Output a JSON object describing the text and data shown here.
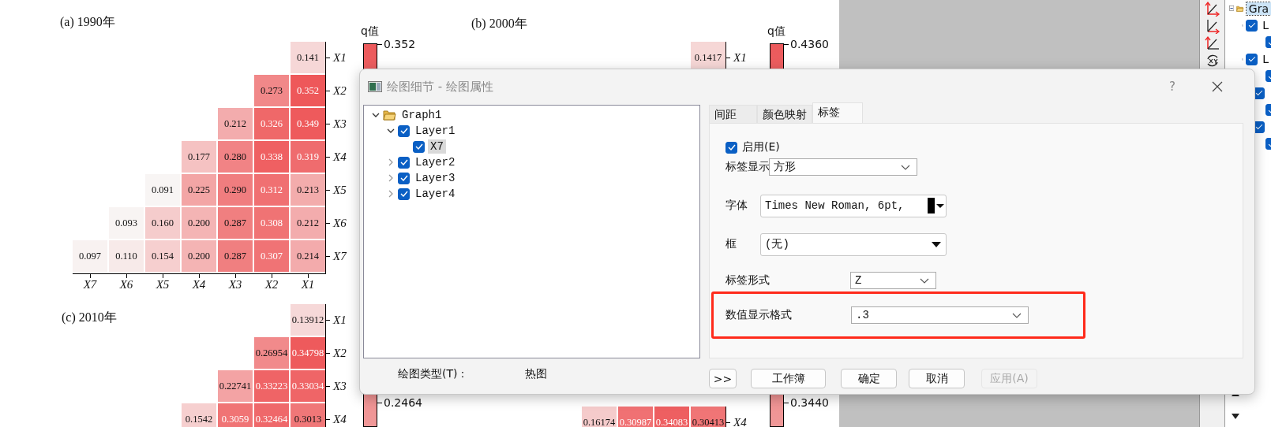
{
  "panel_a": {
    "title": "(a) 1990年",
    "rows": [
      {
        "label": "X1",
        "cells": [
          "",
          "",
          "",
          "",
          "",
          "",
          "0.141"
        ]
      },
      {
        "label": "X2",
        "cells": [
          "",
          "",
          "",
          "",
          "",
          "0.273",
          "0.352"
        ]
      },
      {
        "label": "X3",
        "cells": [
          "",
          "",
          "",
          "",
          "0.212",
          "0.326",
          "0.349"
        ]
      },
      {
        "label": "X4",
        "cells": [
          "",
          "",
          "",
          "0.177",
          "0.280",
          "0.338",
          "0.319"
        ]
      },
      {
        "label": "X5",
        "cells": [
          "",
          "",
          "0.091",
          "0.225",
          "0.290",
          "0.312",
          "0.213"
        ]
      },
      {
        "label": "X6",
        "cells": [
          "",
          "0.093",
          "0.160",
          "0.200",
          "0.287",
          "0.308",
          "0.212"
        ]
      },
      {
        "label": "X7",
        "cells": [
          "0.097",
          "0.110",
          "0.154",
          "0.200",
          "0.287",
          "0.307",
          "0.214"
        ]
      }
    ],
    "x_labels": [
      "X7",
      "X6",
      "X5",
      "X4",
      "X3",
      "X2",
      "X1"
    ]
  },
  "panel_b": {
    "title": "(b) 2000年",
    "top_rows": [
      {
        "label": "X1",
        "cells": [
          "",
          "",
          "",
          "",
          "",
          "",
          "0.1417"
        ]
      }
    ],
    "bottom_rows": [
      {
        "label": "X4",
        "cells": [
          "",
          "",
          "",
          "0.16174",
          "0.30987",
          "0.34083",
          "0.30413"
        ]
      }
    ]
  },
  "panel_c": {
    "title": "(c) 2010年",
    "rows": [
      {
        "label": "X1",
        "cells": [
          "",
          "",
          "",
          "",
          "",
          "",
          "0.13912"
        ]
      },
      {
        "label": "X2",
        "cells": [
          "",
          "",
          "",
          "",
          "",
          "0.26954",
          "0.34798"
        ]
      },
      {
        "label": "X3",
        "cells": [
          "",
          "",
          "",
          "",
          "0.22741",
          "0.33223",
          "0.33034"
        ]
      },
      {
        "label": "X4",
        "cells": [
          "",
          "",
          "",
          "0.1542",
          "0.3059",
          "0.32464",
          "0.3013"
        ]
      }
    ]
  },
  "color_bars": [
    {
      "title": "q值",
      "top_label": "0.352",
      "bottom_label": "0.2464"
    },
    {
      "title": "q值",
      "top_label": "0.4360",
      "bottom_label": "0.3440"
    }
  ],
  "object_tree": [
    {
      "label": "Gra",
      "selected": true,
      "expanded": true,
      "children": [
        {
          "label": "L",
          "checked": true,
          "selected": false,
          "expanded": true,
          "children": [
            {
              "checked": true
            }
          ]
        },
        {
          "label": "L",
          "checked": true,
          "selected": false,
          "expanded": true,
          "children": [
            {
              "checked": true
            }
          ]
        },
        {
          "checked": true,
          "children": [
            {
              "checked": true
            }
          ]
        },
        {
          "checked": true,
          "children": [
            {
              "checked": true
            }
          ]
        }
      ]
    }
  ],
  "dialog": {
    "title": "绘图细节 - 绘图属性",
    "help": "?",
    "tree": [
      {
        "label": "Graph1",
        "selected": false,
        "expanded": true,
        "children": [
          {
            "label": "Layer1",
            "checked": true,
            "selected": false,
            "expanded": true,
            "children": [
              {
                "label": "X7",
                "checked": true,
                "selected": true
              }
            ]
          },
          {
            "label": "Layer2",
            "checked": true,
            "selected": false,
            "expanded": false
          },
          {
            "label": "Layer3",
            "checked": true,
            "selected": false,
            "expanded": false
          },
          {
            "label": "Layer4",
            "checked": true,
            "selected": false,
            "expanded": false
          }
        ]
      }
    ],
    "plot_type_label": "绘图类型(T)：",
    "plot_type_value": "热图",
    "tabs": [
      {
        "label": "间距",
        "selected": false
      },
      {
        "label": "颜色映射",
        "selected": false
      },
      {
        "label": "标签",
        "selected": true
      }
    ],
    "enable": {
      "label": "启用(E)",
      "checked": true
    },
    "fields": [
      {
        "kind": "dropdown",
        "label": "标签显示",
        "value": "方形",
        "highlighted": false
      },
      {
        "kind": "font",
        "label": "字体",
        "value": "Times New Roman, 6pt,",
        "highlighted": false
      },
      {
        "kind": "combo",
        "label": "框",
        "value": "(无)",
        "highlighted": false
      },
      {
        "kind": "dropdown",
        "label": "标签形式",
        "value": "Z",
        "highlighted": false
      },
      {
        "kind": "dropdown",
        "label": "数值显示格式",
        "value": ".3",
        "highlighted": true
      }
    ],
    "buttons": [
      {
        "label": ">>",
        "disabled": false
      },
      {
        "label": "工作簿",
        "disabled": false
      },
      {
        "label": "确定",
        "disabled": false
      },
      {
        "label": "取消",
        "disabled": false
      },
      {
        "label": "应用(A)",
        "disabled": true
      }
    ]
  }
}
